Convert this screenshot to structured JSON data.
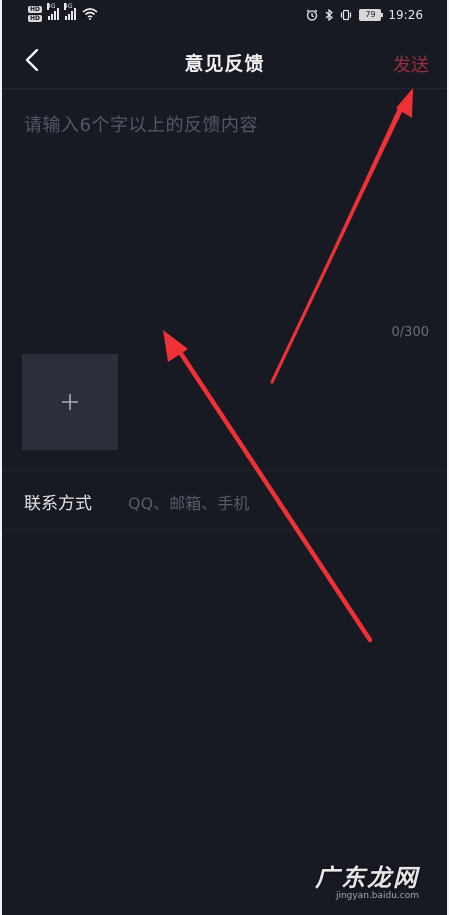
{
  "status_bar": {
    "hd_badge_1": "HD",
    "hd_badge_2": "HD",
    "network_1": "4G",
    "network_2": "4G",
    "battery": "79",
    "time": "19:26"
  },
  "nav": {
    "title": "意见反馈",
    "send_label": "发送",
    "back_icon": "chevron-left-icon"
  },
  "feedback": {
    "placeholder": "请输入6个字以上的反馈内容",
    "counter": "0/300",
    "add_image_icon": "plus-icon"
  },
  "contact": {
    "label": "联系方式",
    "placeholder": "QQ、邮箱、手机"
  },
  "watermark": {
    "logo": "广东龙网",
    "url": "jingyan.baidu.com"
  },
  "colors": {
    "background": "#171923",
    "send_accent": "#9a2e3e",
    "arrow": "#e8333a",
    "placeholder": "#545864"
  }
}
